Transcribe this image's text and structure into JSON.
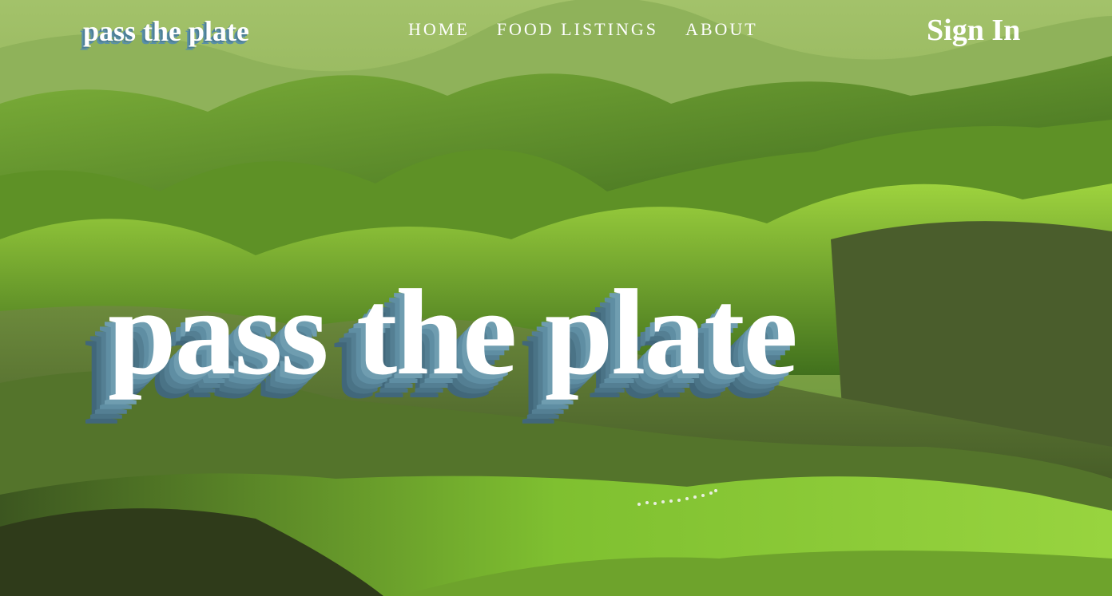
{
  "brand": {
    "name": "pass the plate"
  },
  "nav": {
    "links": [
      {
        "label": "HOME"
      },
      {
        "label": "FOOD LISTINGS"
      },
      {
        "label": "ABOUT"
      }
    ],
    "signin_label": "Sign In"
  },
  "hero": {
    "title": "pass the plate",
    "background": "green rolling hills landscape photo"
  },
  "colors": {
    "text": "#ffffff",
    "shadow": "#4d7f95",
    "hills_light": "#8ccf3a",
    "hills_dark": "#2f4d1c"
  }
}
